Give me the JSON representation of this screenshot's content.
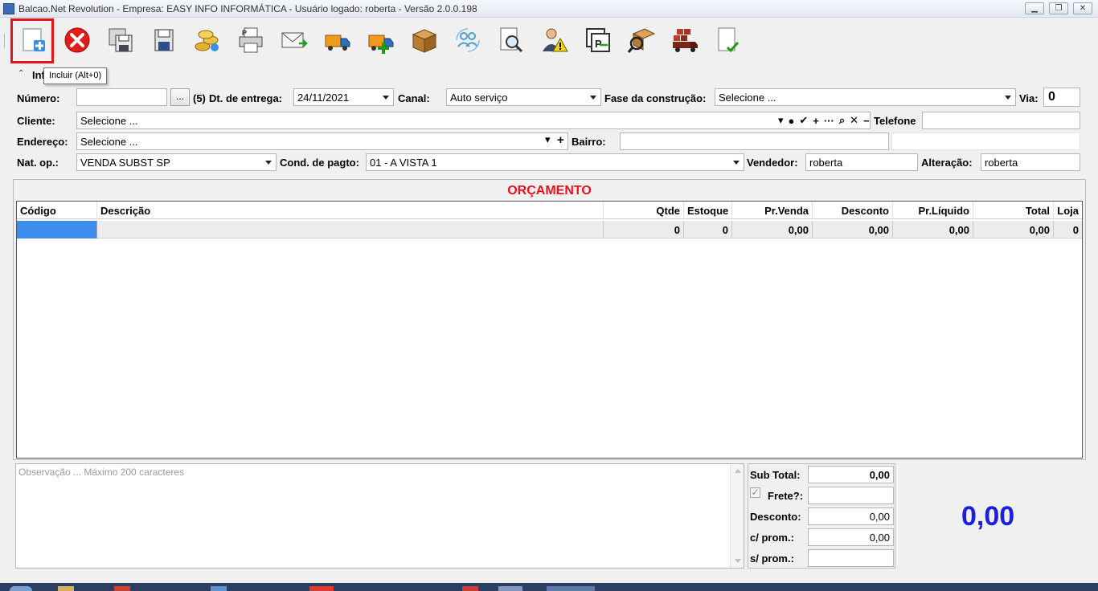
{
  "window": {
    "title": "Balcao.Net Revolution - Empresa: EASY INFO INFORMÁTICA - Usuário logado: roberta - Versão 2.0.0.198"
  },
  "toolbar": {
    "icons": [
      "add-document-icon",
      "cancel-icon",
      "save-all-icon",
      "save-icon",
      "coins-icon",
      "print-icon",
      "email-icon",
      "truck-icon",
      "truck-add-icon",
      "box-icon",
      "users-sync-icon",
      "document-search-icon",
      "user-warning-icon",
      "transfer-document-icon",
      "box-search-icon",
      "truck-load-icon",
      "document-check-icon"
    ],
    "tooltip": "Incluir (Alt+0)"
  },
  "section": {
    "label": "Inf"
  },
  "form": {
    "numero_label": "Número:",
    "numero_value": "",
    "ellipsis": "...",
    "counter": "(5)",
    "dt_entrega_label": "Dt. de entrega:",
    "dt_entrega_value": "24/11/2021",
    "canal_label": "Canal:",
    "canal_value": "Auto serviço",
    "fase_label": "Fase da construção:",
    "fase_value": "Selecione ...",
    "via_label": "Via:",
    "via_value": "0",
    "cliente_label": "Cliente:",
    "cliente_value": "Selecione ...",
    "telefone_label": "Telefone",
    "telefone_value": "",
    "endereco_label": "Endereço:",
    "endereco_value": "Selecione ...",
    "bairro_label": "Bairro:",
    "bairro_value": "",
    "natop_label": "Nat. op.:",
    "natop_value": "VENDA SUBST SP",
    "condpagto_label": "Cond. de pagto:",
    "condpagto_value": "01 - A VISTA 1",
    "vendedor_label": "Vendedor:",
    "vendedor_value": "roberta",
    "alteracao_label": "Alteração:",
    "alteracao_value": "roberta",
    "cliente_tools": [
      "▾",
      "●",
      "✔",
      "+",
      "···",
      "⌕",
      "✕",
      "−"
    ],
    "endereco_tools": [
      "▾",
      "+"
    ]
  },
  "orcamento": {
    "title": "ORÇAMENTO",
    "columns": [
      "Código",
      "Descrição",
      "Qtde",
      "Estoque",
      "Pr.Venda",
      "Desconto",
      "Pr.Líquido",
      "Total",
      "Loja"
    ],
    "rows": [
      [
        "",
        "",
        "0",
        "0",
        "0,00",
        "0,00",
        "0,00",
        "0,00",
        "0"
      ]
    ]
  },
  "observacao": {
    "placeholder": "Observação ... Máximo 200 caracteres"
  },
  "totals": {
    "subtotal_label": "Sub Total:",
    "subtotal_value": "0,00",
    "frete_label": "Frete?:",
    "frete_checked": true,
    "frete_value": "",
    "desconto_label": "Desconto:",
    "desconto_value": "0,00",
    "cprom_label": "c/ prom.:",
    "cprom_value": "0,00",
    "sprom_label": "s/ prom.:",
    "sprom_value": "",
    "grand_total": "0,00"
  },
  "colors": {
    "accent_red": "#e8121a",
    "total_blue": "#1a1fe0",
    "selection_blue": "#3c8dee"
  }
}
